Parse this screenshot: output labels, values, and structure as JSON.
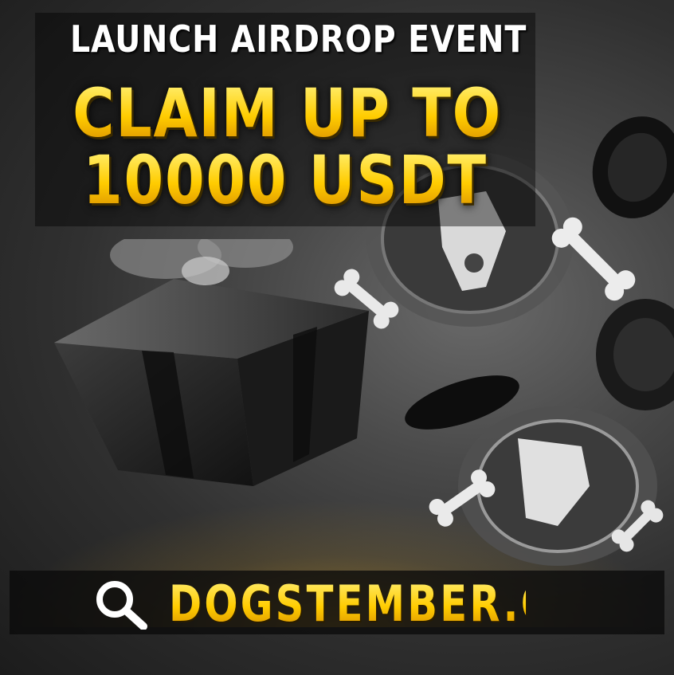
{
  "headline": {
    "event": "LAUNCH AIRDROP EVENT",
    "claim_line1": "CLAIM UP TO",
    "claim_line2": "10000 USDT"
  },
  "banner": {
    "site": "DOGSTEMBER.ONE",
    "icon": "search-icon"
  },
  "colors": {
    "accent_gold": "#ffcc00",
    "headline_white": "#ffffff",
    "background": "#3a3a3a"
  }
}
